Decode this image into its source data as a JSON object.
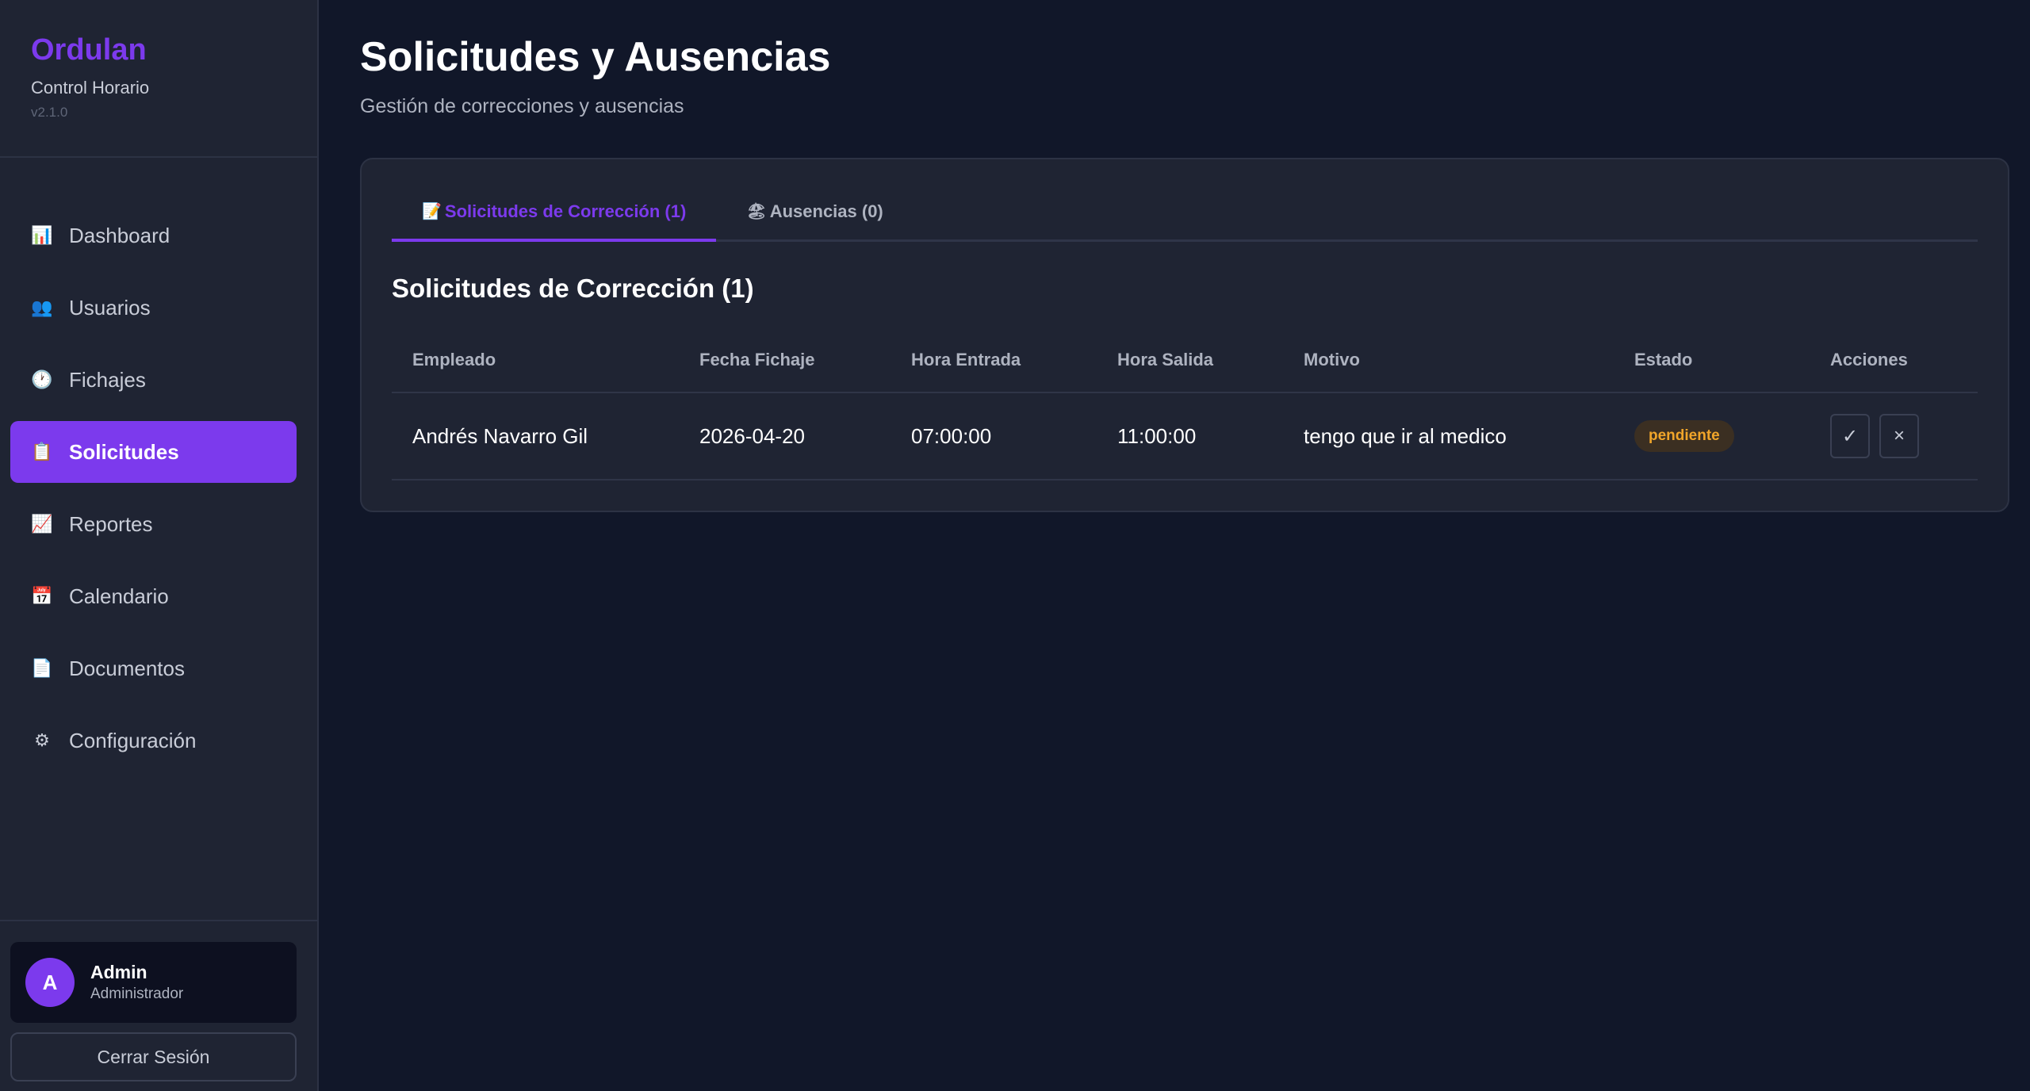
{
  "brand": {
    "name": "Ordulan",
    "subtitle": "Control Horario",
    "version": "v2.1.0"
  },
  "sidebar": {
    "items": [
      {
        "label": "Dashboard",
        "icon": "📊",
        "icon_name": "bar-chart-icon",
        "active": false
      },
      {
        "label": "Usuarios",
        "icon": "👥",
        "icon_name": "users-icon",
        "active": false
      },
      {
        "label": "Fichajes",
        "icon": "🕐",
        "icon_name": "clock-icon",
        "active": false
      },
      {
        "label": "Solicitudes",
        "icon": "📋",
        "icon_name": "clipboard-icon",
        "active": true
      },
      {
        "label": "Reportes",
        "icon": "📈",
        "icon_name": "trend-chart-icon",
        "active": false
      },
      {
        "label": "Calendario",
        "icon": "📅",
        "icon_name": "calendar-icon",
        "active": false
      },
      {
        "label": "Documentos",
        "icon": "📄",
        "icon_name": "document-icon",
        "active": false
      },
      {
        "label": "Configuración",
        "icon": "⚙",
        "icon_name": "gear-icon",
        "active": false
      }
    ]
  },
  "user": {
    "initial": "A",
    "name": "Admin",
    "role": "Administrador"
  },
  "logout_label": "Cerrar Sesión",
  "page": {
    "title": "Solicitudes y Ausencias",
    "subtitle": "Gestión de correcciones y ausencias"
  },
  "tabs": [
    {
      "icon": "📝",
      "label": "Solicitudes de Corrección (1)",
      "active": true
    },
    {
      "icon": "🏖",
      "label": "Ausencias (0)",
      "active": false
    }
  ],
  "section_title": "Solicitudes de Corrección (1)",
  "table": {
    "headers": [
      "Empleado",
      "Fecha Fichaje",
      "Hora Entrada",
      "Hora Salida",
      "Motivo",
      "Estado",
      "Acciones"
    ],
    "rows": [
      {
        "empleado": "Andrés Navarro Gil",
        "fecha": "2026-04-20",
        "entrada": "07:00:00",
        "salida": "11:00:00",
        "motivo": "tengo que ir al medico",
        "estado": "pendiente",
        "approve_icon": "✓",
        "reject_icon": "×"
      }
    ]
  },
  "colors": {
    "accent": "#7c3aed",
    "pending": "#f0a52a",
    "background": "#111729",
    "panel": "#1f2433"
  }
}
